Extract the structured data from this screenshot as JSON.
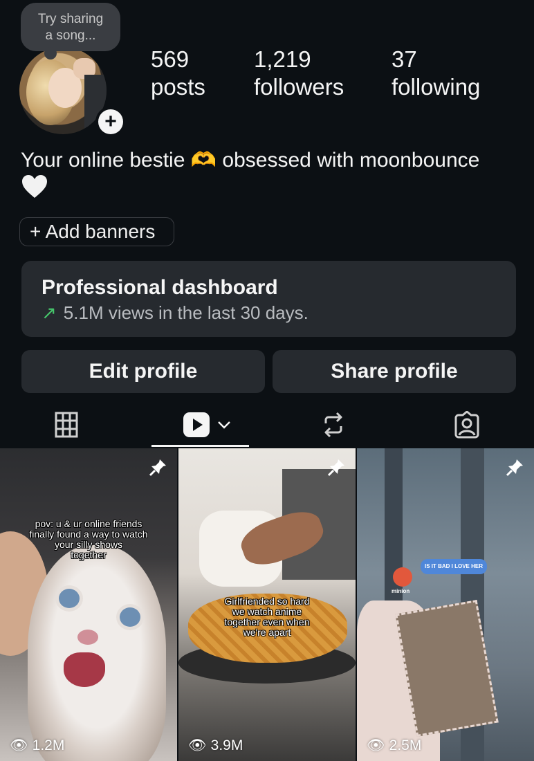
{
  "note": {
    "line1": "Try sharing",
    "line2": "a song..."
  },
  "stats": [
    {
      "value": "569",
      "label": "posts"
    },
    {
      "value": "1,219",
      "label": "followers"
    },
    {
      "value": "37",
      "label": "following"
    }
  ],
  "bio": {
    "text": "Your online bestie 🫶 obsessed with moonbounce",
    "heart": "white-heart-emoji"
  },
  "add_banners": "+ Add banners",
  "dashboard": {
    "title": "Professional dashboard",
    "subtitle": "5.1M views in the last 30 days.",
    "trend_icon": "trend-up-arrow"
  },
  "buttons": {
    "edit": "Edit profile",
    "share": "Share profile"
  },
  "tabs": [
    {
      "icon": "grid-icon"
    },
    {
      "icon": "reels-icon",
      "selected": true
    },
    {
      "icon": "reposts-icon"
    },
    {
      "icon": "tagged-icon"
    }
  ],
  "posts": [
    {
      "caption": [
        "pov: u & ur online friends",
        "finally found a way to watch",
        "your silly shows",
        "together"
      ],
      "views": "1.2M",
      "pinned": true
    },
    {
      "caption": [
        "Girlfriended so hard",
        "we watch anime",
        "together even when",
        "we're apart"
      ],
      "views": "3.9M",
      "pinned": true
    },
    {
      "caption": [
        "IS IT BAD I LOVE HER"
      ],
      "sticker_label": "minion",
      "views": "2.5M",
      "pinned": true
    }
  ],
  "colors": {
    "background": "#0c1014",
    "surface": "#262a2f",
    "accent_green": "#46c46b"
  }
}
